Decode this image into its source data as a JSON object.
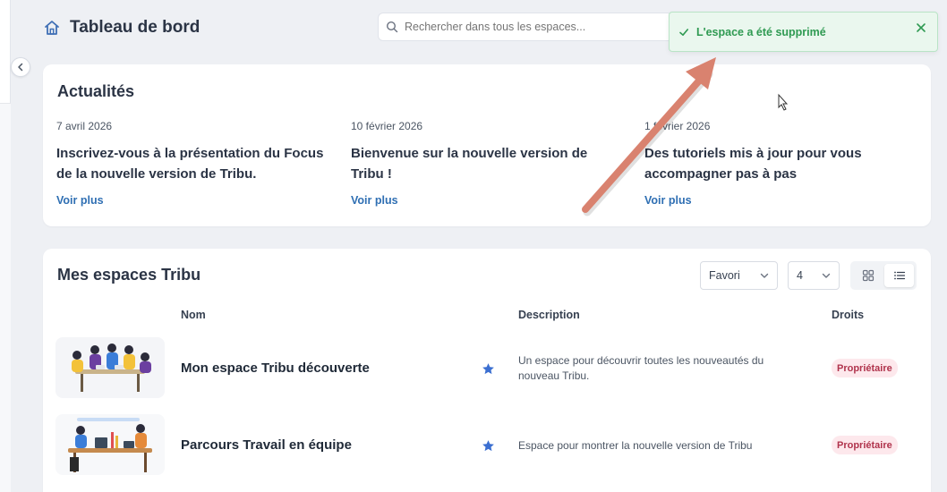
{
  "header": {
    "title": "Tableau de bord"
  },
  "search": {
    "placeholder": "Rechercher dans tous les espaces..."
  },
  "toast": {
    "message": "L'espace a été supprimé",
    "status_color": "#2f9a52"
  },
  "news": {
    "title": "Actualités",
    "items": [
      {
        "date": "7 avril 2026",
        "headline": "Inscrivez-vous à la présentation du Focus de la nouvelle version de Tribu.",
        "link": "Voir plus"
      },
      {
        "date": "10 février 2026",
        "headline": "Bienvenue sur la nouvelle version de Tribu !",
        "link": "Voir plus"
      },
      {
        "date": "1 février 2026",
        "headline": "Des tutoriels mis à jour pour vous accompagner pas à pas",
        "link": "Voir plus"
      }
    ]
  },
  "spaces": {
    "title": "Mes espaces Tribu",
    "sort_select": {
      "value": "Favori"
    },
    "count_select": {
      "value": "4"
    },
    "columns": [
      "Nom",
      "Description",
      "Droits"
    ],
    "rows": [
      {
        "name": "Mon espace Tribu découverte",
        "description": "Un espace pour découvrir toutes les nouveautés du nouveau Tribu.",
        "right": "Propriétaire",
        "favorite": true
      },
      {
        "name": "Parcours Travail en équipe",
        "description": "Espace pour montrer la nouvelle version de Tribu",
        "right": "Propriétaire",
        "favorite": true
      }
    ]
  },
  "colors": {
    "accent": "#2f6fb3",
    "star": "#3b6fd1",
    "badge_bg": "#fde8ec",
    "badge_text": "#b0334c",
    "annotation_arrow": "#d9826f"
  }
}
